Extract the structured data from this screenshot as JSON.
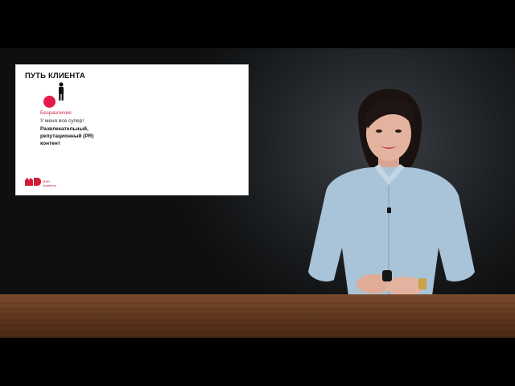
{
  "slide": {
    "title": "ПУТЬ КЛИЕНТА",
    "stage": "Безразличие",
    "quote": "У меня все супер!",
    "content_line1": "Развлекательный,",
    "content_line2": "репутационный (PR)",
    "content_line3": "контент",
    "logo_text_1": "MAD",
    "logo_text_2": "Academy",
    "accent_color": "#e6194b"
  },
  "icons": {
    "marker": "red-circle-icon",
    "figure": "person-icon",
    "logo": "mad-academy-logo"
  }
}
